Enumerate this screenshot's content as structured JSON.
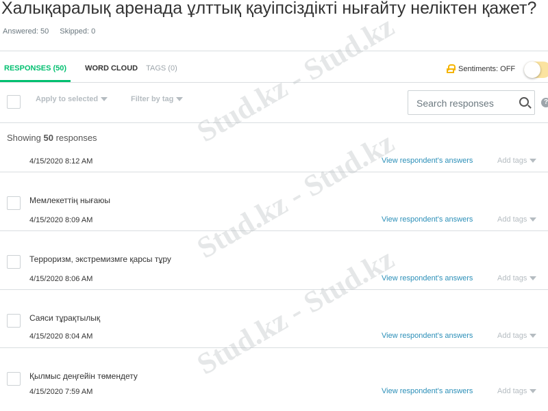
{
  "question": {
    "title": "Халықаралық аренада ұлттық қауіпсіздікті нығайту неліктен қажет?",
    "answered": "Answered: 50",
    "skipped": "Skipped: 0"
  },
  "tabs": [
    {
      "label": "RESPONSES (50)"
    },
    {
      "label": "WORD CLOUD"
    },
    {
      "label": "TAGS (0)"
    }
  ],
  "sentiments": {
    "label": "Sentiments: OFF",
    "enabled": false
  },
  "toolbar": {
    "apply": "Apply to selected",
    "filter": "Filter by tag",
    "search_placeholder": "Search responses",
    "help": "?"
  },
  "showing": {
    "prefix": "Showing ",
    "count": "50",
    "suffix": " responses"
  },
  "row_actions": {
    "view": "View respondent's answers",
    "add_tags": "Add tags"
  },
  "responses": [
    {
      "text": "",
      "date": "4/15/2020 8:12 AM"
    },
    {
      "text": "Мемлекеттің нығаюы",
      "date": "4/15/2020 8:09 AM"
    },
    {
      "text": "Терроризм, экстремизмге қарсы тұру",
      "date": "4/15/2020 8:06 AM"
    },
    {
      "text": "Саяси тұрақтылық",
      "date": "4/15/2020 8:04 AM"
    },
    {
      "text": "Қылмыс деңгейін төмендету",
      "date": "4/15/2020 7:59 AM"
    }
  ],
  "watermark": "Stud.kz - Stud.kz"
}
